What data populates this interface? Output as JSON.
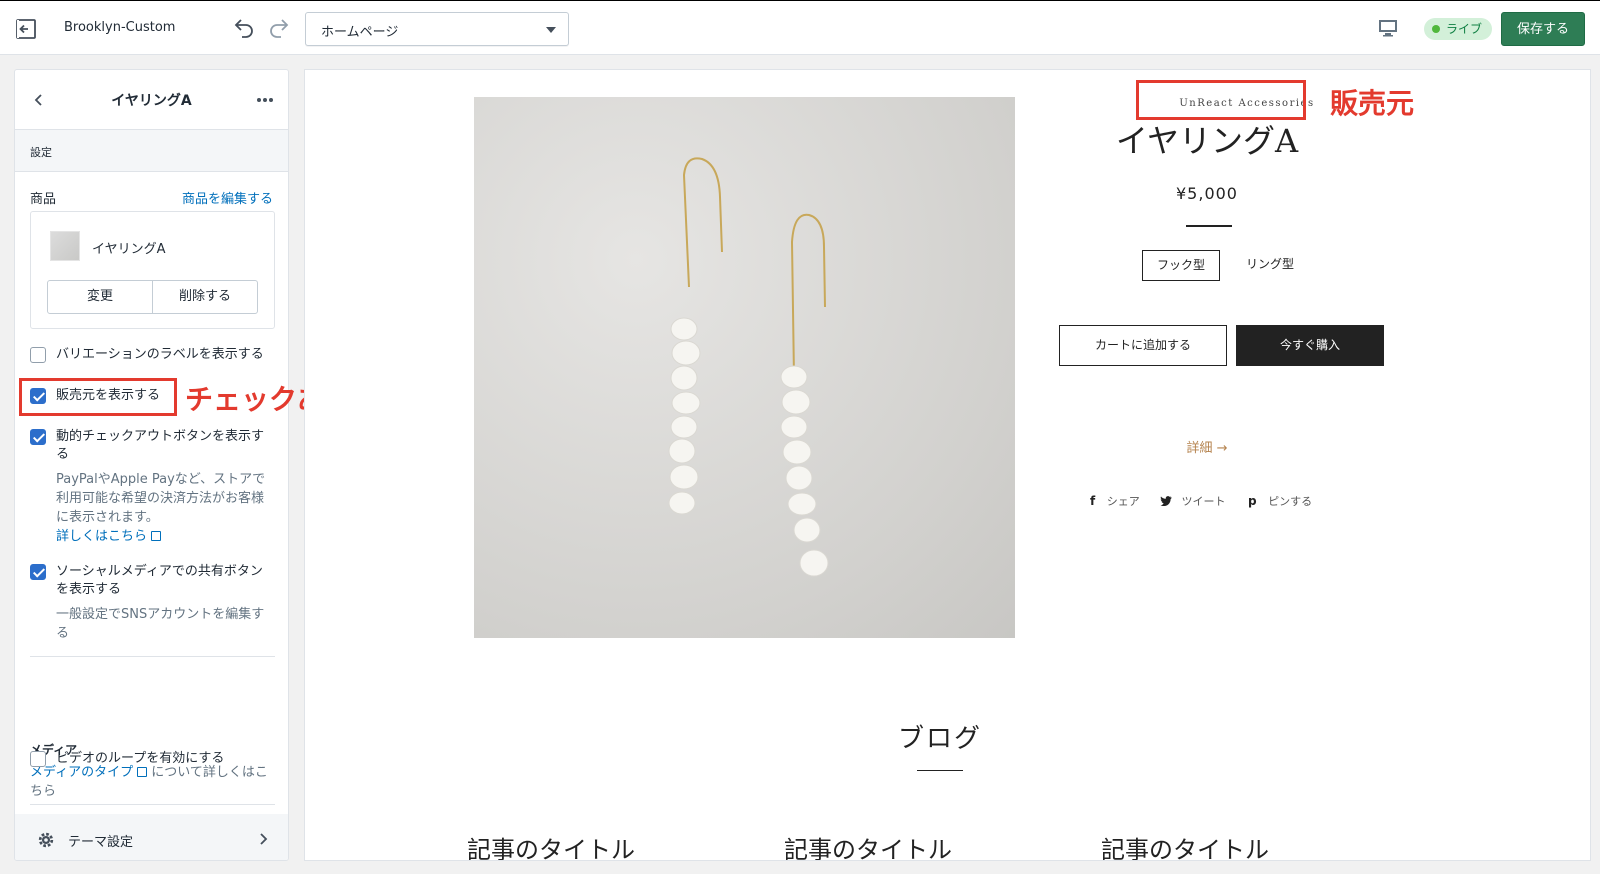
{
  "topbar": {
    "store_name": "Brooklyn-Custom",
    "page_select_value": "ホームページ",
    "live_badge": "ライブ",
    "save_label": "保存する",
    "colors": {
      "save": "#2e7d55",
      "live_bg": "#d3f0d9",
      "live_text": "#108043"
    }
  },
  "sidebar": {
    "title": "イヤリングA",
    "section_label": "設定",
    "product_label": "商品",
    "edit_product_link": "商品を編集する",
    "product_name": "イヤリングA",
    "change_button": "変更",
    "delete_button": "削除する",
    "show_variant_labels": {
      "label": "バリエーションのラベルを表示する",
      "checked": false
    },
    "show_vendor": {
      "label": "販売元を表示する",
      "checked": true
    },
    "dynamic_checkout": {
      "label": "動的チェックアウトボタンを表示する",
      "checked": true,
      "help": "PayPalやApple Payなど、ストアで利用可能な希望の決済方法がお客様に表示されます。",
      "learn_more": "詳しくはこちら"
    },
    "social_sharing": {
      "label": "ソーシャルメディアでの共有ボタンを表示する",
      "checked": true,
      "help": "一般設定でSNSアカウントを編集する"
    },
    "media_heading": "メディア",
    "media_link": "メディアのタイプ",
    "media_text": "について詳しくはこちら",
    "video_loop": {
      "label": "ビデオのループを有効にする",
      "checked": false
    },
    "theme_settings": "テーマ設定"
  },
  "annotations": {
    "checked_note": "チェックあり",
    "vendor_note": "販売元",
    "color": "#e33a2e"
  },
  "preview": {
    "vendor": "UnReact Accessories",
    "product_title": "イヤリングA",
    "price": "¥5,000",
    "options": [
      "フック型",
      "リング型"
    ],
    "add_to_cart": "カートに追加する",
    "buy_now": "今すぐ購入",
    "details_link": "詳細 →",
    "share": {
      "facebook": "シェア",
      "twitter": "ツイート",
      "pinterest": "ピンする"
    },
    "blog_heading": "ブログ",
    "article_titles": [
      "記事のタイトル",
      "記事のタイトル",
      "記事のタイトル"
    ]
  }
}
